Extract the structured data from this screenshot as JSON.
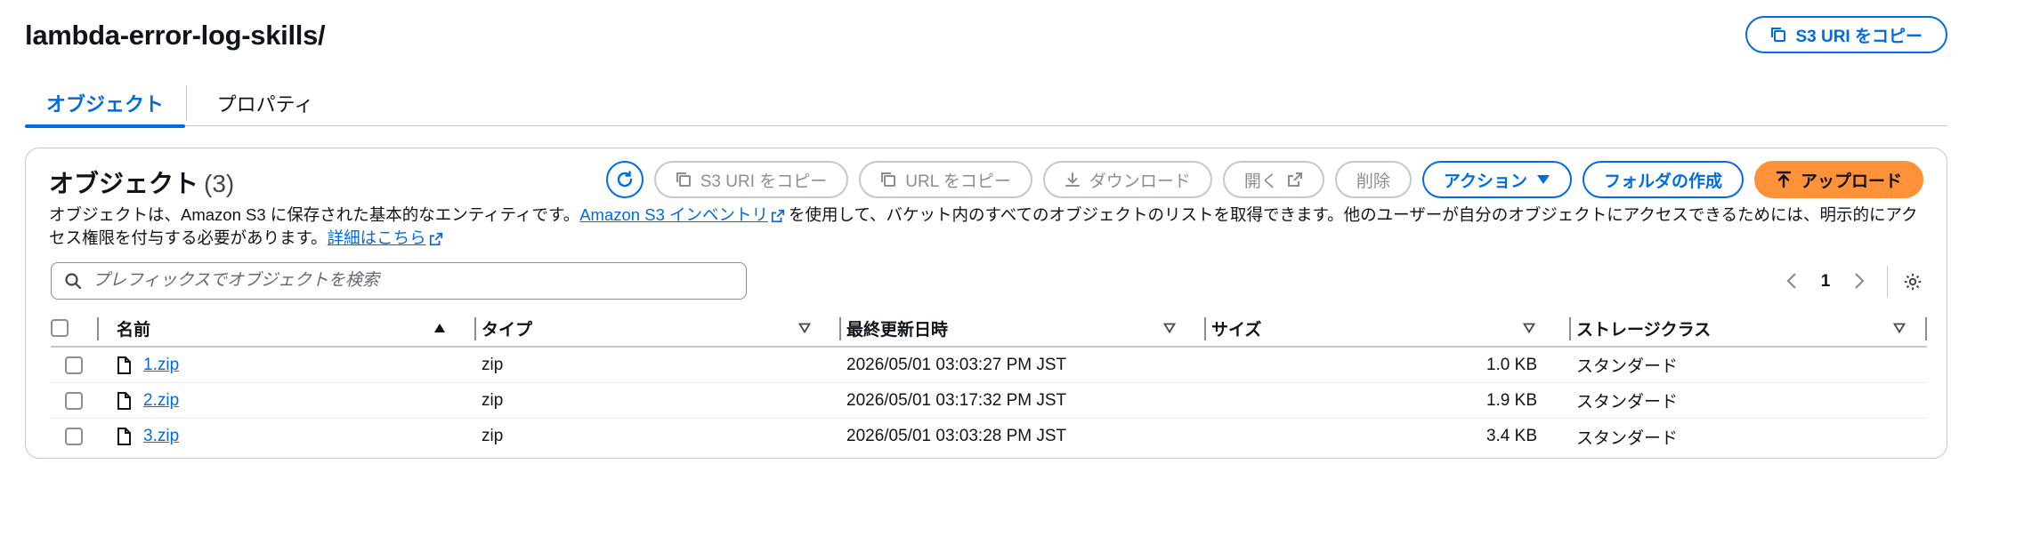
{
  "header": {
    "title": "lambda-error-log-skills/",
    "copy_uri_label": "S3 URI をコピー"
  },
  "tabs": [
    {
      "label": "オブジェクト",
      "active": true
    },
    {
      "label": "プロパティ",
      "active": false
    }
  ],
  "objects_panel": {
    "title": "オブジェクト",
    "count": "(3)",
    "toolbar": {
      "refresh_icon": "refresh-icon",
      "copy_s3_uri": "S3 URI をコピー",
      "copy_url": "URL をコピー",
      "download": "ダウンロード",
      "open": "開く",
      "delete": "削除",
      "actions": "アクション",
      "create_folder": "フォルダの作成",
      "upload": "アップロード"
    },
    "description": {
      "part1": "オブジェクトは、Amazon S3 に保存された基本的なエンティティです。",
      "link1": "Amazon S3 インベントリ",
      "part2": "を使用して、バケット内のすべてのオブジェクトのリストを取得できます。他のユーザーが自分のオブジェクトにアクセスできるためには、明示的にアクセス権限を付与する必要があります。",
      "link2": "詳細はこちら"
    },
    "search": {
      "placeholder": "プレフィックスでオブジェクトを検索",
      "value": ""
    },
    "pagination": {
      "current_page": "1"
    },
    "table": {
      "columns": {
        "name": "名前",
        "type": "タイプ",
        "modified": "最終更新日時",
        "size": "サイズ",
        "storage_class": "ストレージクラス"
      },
      "rows": [
        {
          "name": "1.zip",
          "type": "zip",
          "modified": "2026/05/01 03:03:27 PM JST",
          "size": "1.0 KB",
          "storage_class": "スタンダード"
        },
        {
          "name": "2.zip",
          "type": "zip",
          "modified": "2026/05/01 03:17:32 PM JST",
          "size": "1.9 KB",
          "storage_class": "スタンダード"
        },
        {
          "name": "3.zip",
          "type": "zip",
          "modified": "2026/05/01 03:03:28 PM JST",
          "size": "3.4 KB",
          "storage_class": "スタンダード"
        }
      ]
    }
  },
  "colors": {
    "link_blue": "#006ce0",
    "primary_orange": "#ff9139",
    "border_gray": "#c6c6cd",
    "disabled_gray": "#8c8c94"
  }
}
